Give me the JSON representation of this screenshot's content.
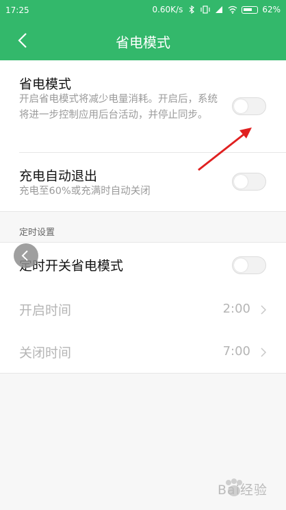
{
  "statusbar": {
    "time": "17:25",
    "net_speed": "0.60K/s",
    "battery": "62%"
  },
  "header": {
    "title": "省电模式"
  },
  "power_saving": {
    "title": "省电模式",
    "description": "开启省电模式将减少电量消耗。开启后，系统将进一步控制应用后台活动，并停止同步。",
    "enabled": false
  },
  "auto_exit": {
    "title": "充电自动退出",
    "description": "充电至60%或充满时自动关闭",
    "enabled": false
  },
  "schedule": {
    "section_label": "定时设置",
    "toggle_title": "定时开关省电模式",
    "enabled": false,
    "start": {
      "label": "开启时间",
      "value": "2:00"
    },
    "end": {
      "label": "关闭时间",
      "value": "7:00"
    }
  },
  "watermark": {
    "text": "Bai经验"
  },
  "colors": {
    "accent": "#33b86b",
    "annotation_arrow": "#e02020"
  }
}
